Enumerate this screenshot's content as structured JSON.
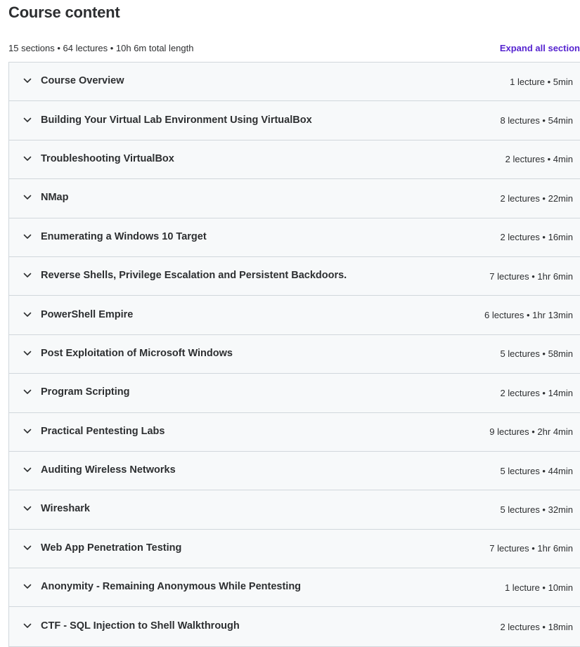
{
  "header": {
    "title": "Course content",
    "summary": "15 sections • 64 lectures • 10h 6m total length",
    "expand_label": "Expand all section"
  },
  "colors": {
    "link": "#5624d0",
    "row_bg": "#f7f9fa",
    "border": "#d1d7dc",
    "text": "#2d2f31"
  },
  "sections": [
    {
      "title": "Course Overview",
      "meta": "1 lecture • 5min",
      "icon": "chevron-down-icon"
    },
    {
      "title": "Building Your Virtual Lab Environment Using VirtualBox",
      "meta": "8 lectures • 54min",
      "icon": "chevron-down-icon"
    },
    {
      "title": "Troubleshooting VirtualBox",
      "meta": "2 lectures • 4min",
      "icon": "chevron-down-icon"
    },
    {
      "title": "NMap",
      "meta": "2 lectures • 22min",
      "icon": "chevron-down-icon"
    },
    {
      "title": "Enumerating a Windows 10 Target",
      "meta": "2 lectures • 16min",
      "icon": "chevron-down-icon"
    },
    {
      "title": "Reverse Shells, Privilege Escalation and Persistent Backdoors.",
      "meta": "7 lectures • 1hr 6min",
      "icon": "chevron-down-icon"
    },
    {
      "title": "PowerShell Empire",
      "meta": "6 lectures • 1hr 13min",
      "icon": "chevron-down-icon"
    },
    {
      "title": "Post Exploitation of Microsoft Windows",
      "meta": "5 lectures • 58min",
      "icon": "chevron-down-icon"
    },
    {
      "title": "Program Scripting",
      "meta": "2 lectures • 14min",
      "icon": "chevron-down-icon"
    },
    {
      "title": "Practical Pentesting Labs",
      "meta": "9 lectures • 2hr 4min",
      "icon": "chevron-down-icon"
    },
    {
      "title": "Auditing Wireless Networks",
      "meta": "5 lectures • 44min",
      "icon": "chevron-down-icon"
    },
    {
      "title": "Wireshark",
      "meta": "5 lectures • 32min",
      "icon": "chevron-down-icon"
    },
    {
      "title": "Web App Penetration Testing",
      "meta": "7 lectures • 1hr 6min",
      "icon": "chevron-down-icon"
    },
    {
      "title": "Anonymity - Remaining Anonymous While Pentesting",
      "meta": "1 lecture • 10min",
      "icon": "chevron-down-icon"
    },
    {
      "title": "CTF - SQL Injection to Shell Walkthrough",
      "meta": "2 lectures • 18min",
      "icon": "chevron-down-icon"
    }
  ]
}
